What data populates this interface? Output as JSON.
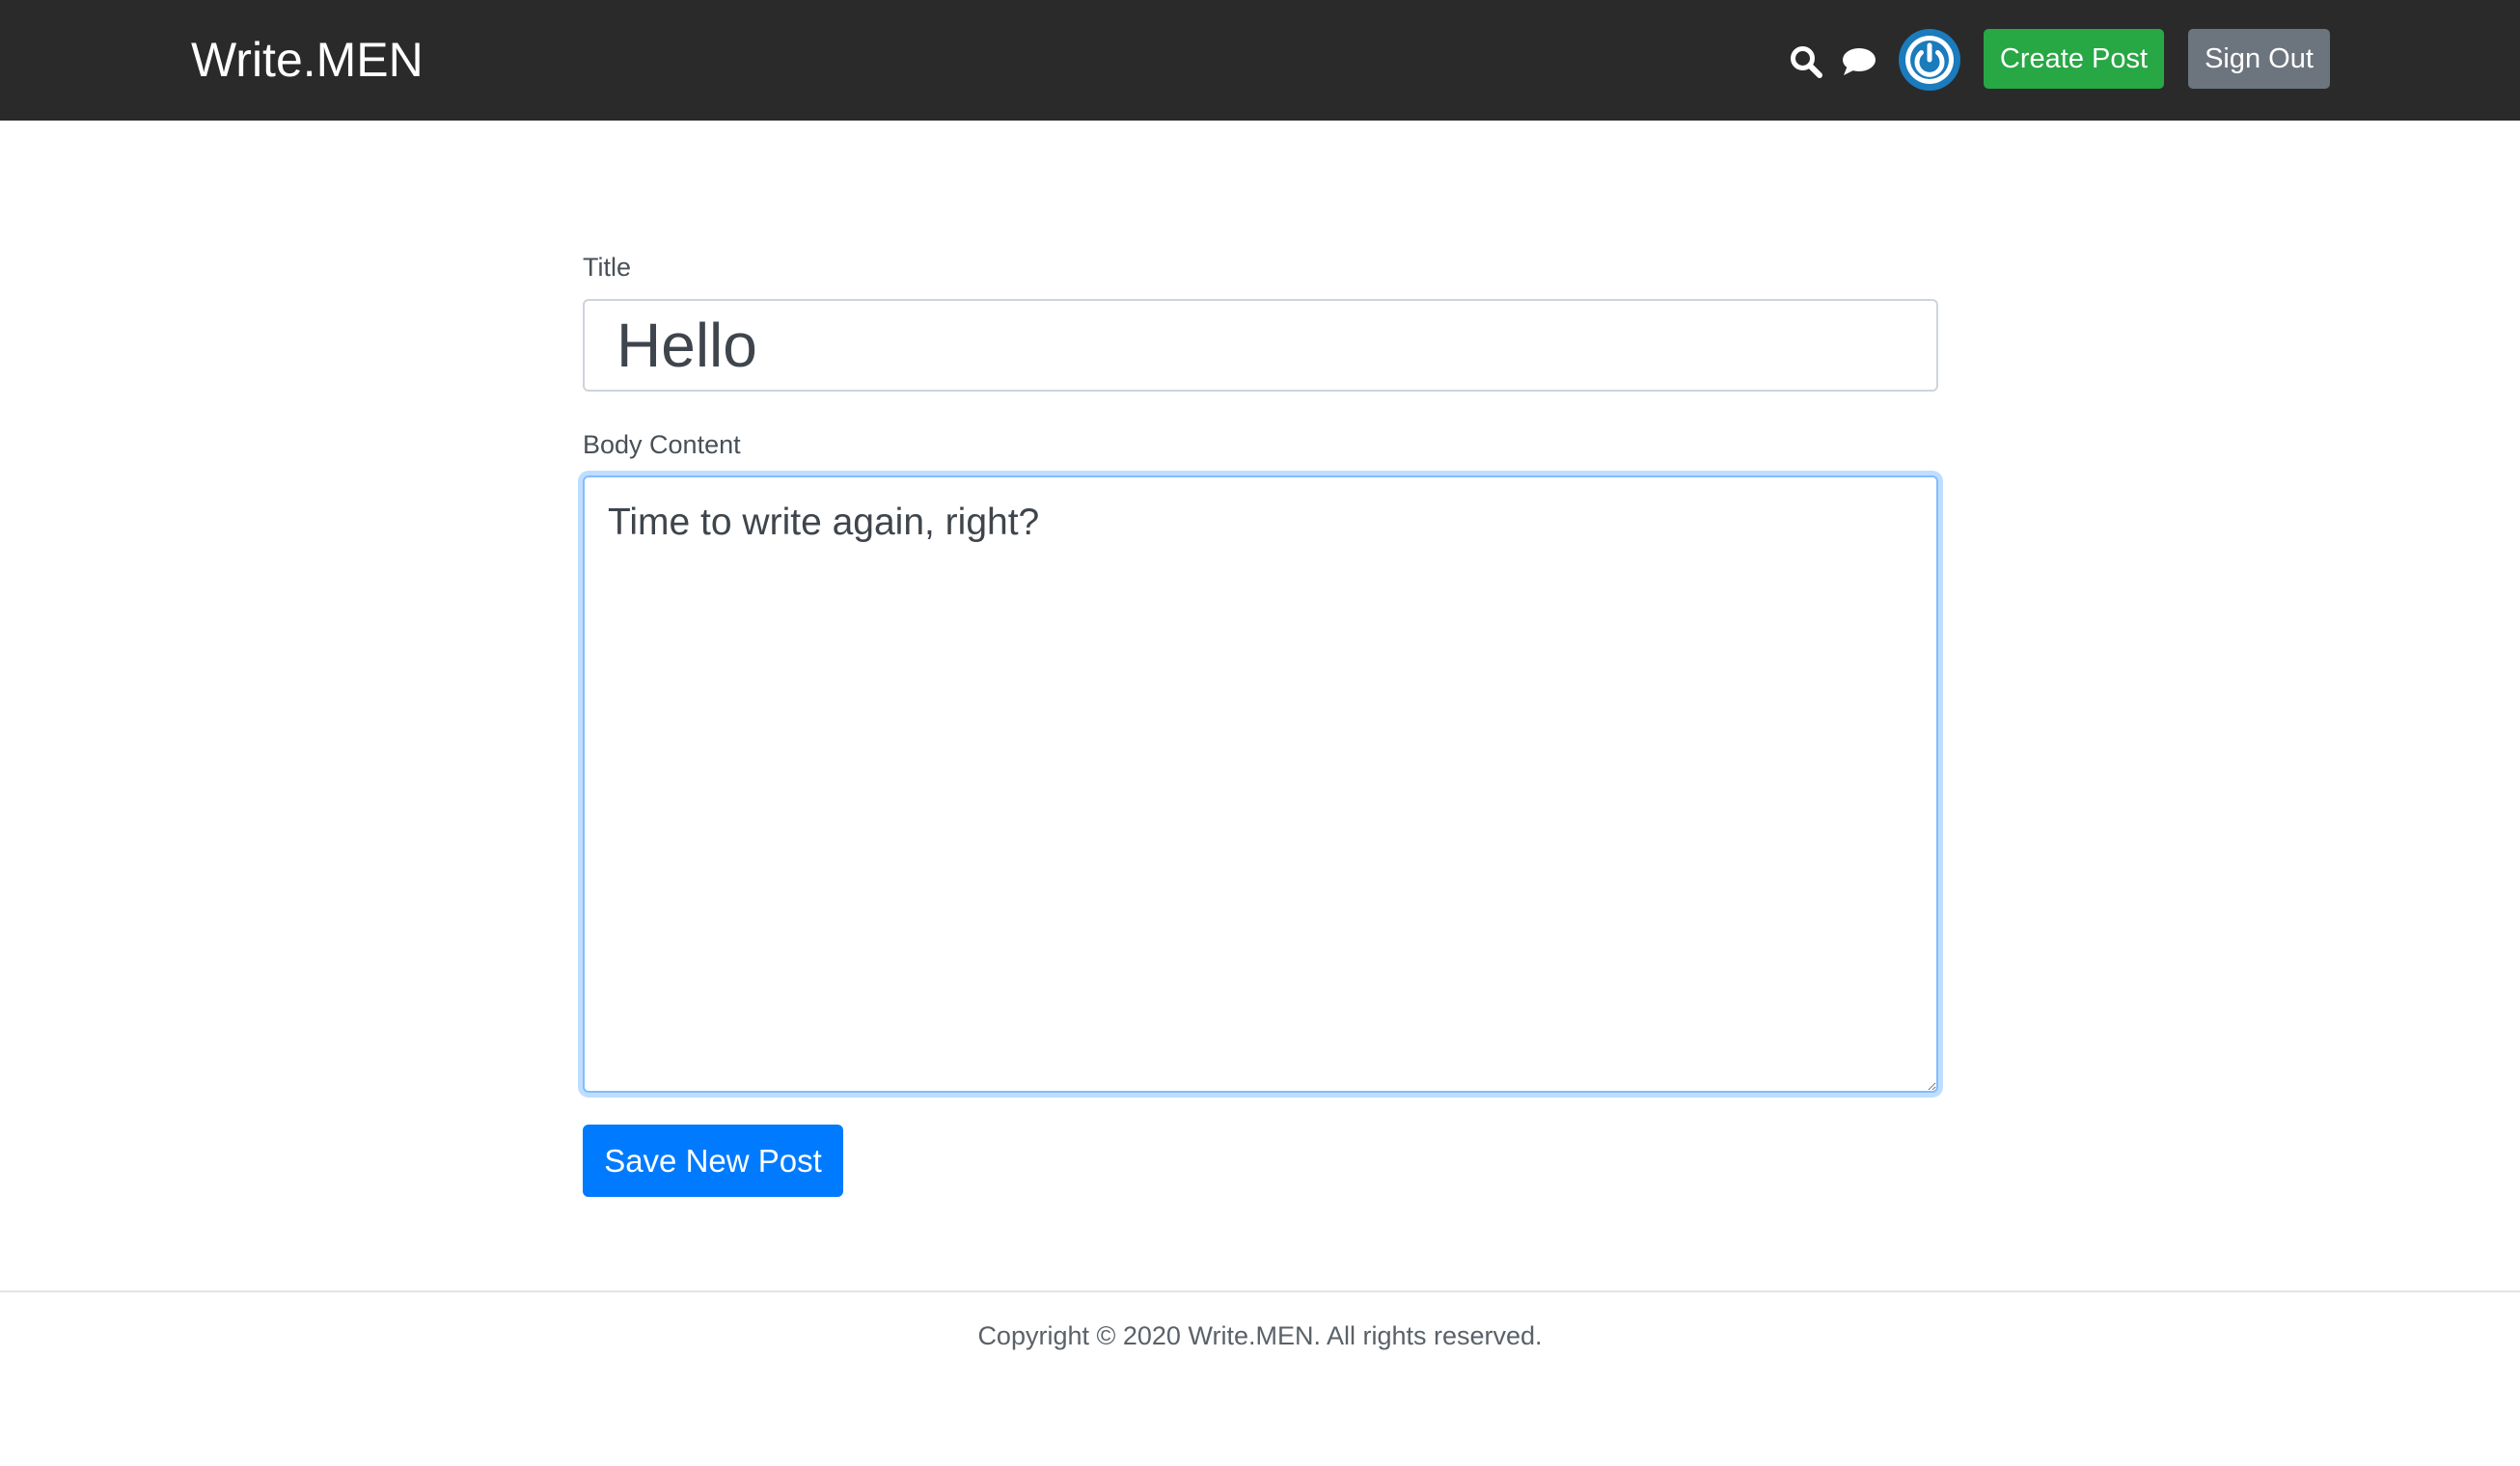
{
  "navbar": {
    "brand": "Write.MEN",
    "icons": {
      "search": "search-icon",
      "chat": "chat-icon",
      "avatar": "power-icon"
    },
    "create_post_label": "Create Post",
    "sign_out_label": "Sign Out"
  },
  "form": {
    "title_label": "Title",
    "title_value": "Hello",
    "body_label": "Body Content",
    "body_value": "Time to write again, right?",
    "save_label": "Save New Post"
  },
  "footer": {
    "copyright": "Copyright © 2020 Write.MEN. All rights reserved."
  },
  "colors": {
    "navbar_bg": "#2a2a2a",
    "create_button": "#28a745",
    "sign_out_button": "#6c757d",
    "save_button": "#007bff",
    "avatar_blue": "#1a7bbd",
    "focus_border": "#80bdff"
  }
}
